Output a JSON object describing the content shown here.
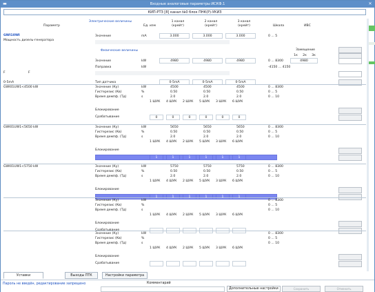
{
  "window": {
    "title": "Входные аналоговые параметры ИСКФ.1"
  },
  "subheader": "КИП-РТЗ [8] канал №0 блок ПНК(Р)-УКИЗ",
  "columns": {
    "param": "Параметр",
    "elec": "Электрические величины",
    "unit": "Ед. изм",
    "ch1": "1 канал (крейт)",
    "ch2": "2 канал (крейт)",
    "ch3": "3 канал (крейт)",
    "scale": "Шкала",
    "ivs": "ИВС"
  },
  "top": {
    "name": "GWI10WI",
    "desc": "Мощность дизель-генератора",
    "row_label": "Значение",
    "unit": "mA",
    "v1": "3.000",
    "v2": "3.000",
    "v3": "3.000",
    "scale": "0 ... 5"
  },
  "phys": {
    "header": "Физические величины",
    "zam_label": "Замещение",
    "zam_cols": [
      "1к",
      "2к",
      "3к"
    ],
    "znach": {
      "label": "Значение",
      "unit": "kW",
      "v1": "4980",
      "v2": "4980",
      "v3": "4980",
      "scale": "0 ... 8300",
      "ivs": "4980"
    },
    "popr": {
      "label": "Поправка",
      "unit": "kW",
      "scale": "-4150 ... 4150"
    },
    "f": "F",
    "f2": "F"
  },
  "tip": {
    "left": "0-5mA",
    "label": "Тип датчика",
    "v1": "0-5mA",
    "v2": "0-5mA",
    "v3": "0-5mA"
  },
  "sections": [
    {
      "name": "GWI01UW1<4500 kW",
      "rows": [
        {
          "label": "Значение (Ку)",
          "unit": "kW",
          "v": [
            "4500",
            "4500",
            "4500"
          ],
          "scale": "0 ... 8300"
        },
        {
          "label": "Гистерезис (Кв)",
          "unit": "%",
          "v": [
            "0.50",
            "0.50",
            "0.50"
          ],
          "scale": "0 ... 5"
        },
        {
          "label": "Время демпф. (Тд)",
          "unit": "s",
          "v": [
            "2.0",
            "2.0",
            "2.0"
          ],
          "scale": "0 ... 10"
        }
      ],
      "shuk": [
        "1 ШУК",
        "4 ШУК",
        "2 ШУК",
        "5 ШУК",
        "3 ШУК",
        "6 ШУК"
      ],
      "block": "Блокирование",
      "trig": "Срабатывание",
      "trigv": [
        "0",
        "0",
        "0",
        "0",
        "0",
        "0"
      ],
      "hl": false
    },
    {
      "name": "GWI01UW1<5650 kW",
      "rows": [
        {
          "label": "Значение (Ку)",
          "unit": "kW",
          "v": [
            "5650",
            "5650",
            "5650"
          ],
          "scale": "0 ... 8300"
        },
        {
          "label": "Гистерезис (Кв)",
          "unit": "%",
          "v": [
            "0.50",
            "0.50",
            "0.50"
          ],
          "scale": "0 ... 5"
        },
        {
          "label": "Время демпф. (Тд)",
          "unit": "s",
          "v": [
            "2.0",
            "2.0",
            "2.0"
          ],
          "scale": "0 ... 10"
        }
      ],
      "shuk": [
        "1 ШУК",
        "4 ШУК",
        "2 ШУК",
        "5 ШУК",
        "3 ШУК",
        "6 ШУК"
      ],
      "block": "Блокирование",
      "trig": "Срабатывание",
      "trigv": [
        "1",
        "1",
        "1",
        "1",
        "1",
        "1"
      ],
      "hl": true
    },
    {
      "name": "GWI01UW1<5750 kW",
      "rows": [
        {
          "label": "Значение (Ку)",
          "unit": "kW",
          "v": [
            "5750",
            "5750",
            "5750"
          ],
          "scale": "0 ... 8300"
        },
        {
          "label": "Гистерезис (Кв)",
          "unit": "%",
          "v": [
            "0.50",
            "0.50",
            "0.50"
          ],
          "scale": "0 ... 5"
        },
        {
          "label": "Время демпф. (Тд)",
          "unit": "s",
          "v": [
            "2.0",
            "2.0",
            "2.0"
          ],
          "scale": "0 ... 10"
        }
      ],
      "shuk": [
        "1 ШУК",
        "4 ШУК",
        "2 ШУК",
        "5 ШУК",
        "3 ШУК",
        "6 ШУК"
      ],
      "block": "Блокирование",
      "trig": "Срабатывание",
      "trigv": [
        "1",
        "1",
        "1",
        "1",
        "1",
        "1"
      ],
      "hl": true
    },
    {
      "name": "",
      "rows": [
        {
          "label": "Значение (Ку)",
          "unit": "kW",
          "v": [
            "",
            "",
            ""
          ],
          "scale": "0 ... 8300"
        },
        {
          "label": "Гистерезис (Кв)",
          "unit": "%",
          "v": [
            "",
            "",
            ""
          ],
          "scale": "0 ... 5"
        },
        {
          "label": "Время демпф. (Тд)",
          "unit": "s",
          "v": [
            "",
            "",
            ""
          ],
          "scale": "0 ... 10"
        }
      ],
      "shuk": [
        "1 ШУК",
        "4 ШУК",
        "2 ШУК",
        "5 ШУК",
        "3 ШУК",
        "6 ШУК"
      ],
      "block": "Блокирование",
      "trig": "Срабатывание",
      "trigv": [
        "",
        "",
        "",
        "",
        "",
        ""
      ],
      "hl": false
    },
    {
      "name": "",
      "rows": [
        {
          "label": "Значение (Ку)",
          "unit": "kW",
          "v": [
            "",
            "",
            ""
          ],
          "scale": "0 ... 8300"
        },
        {
          "label": "Гистерезис (Кв)",
          "unit": "%",
          "v": [
            "",
            "",
            ""
          ],
          "scale": "0 ... 5"
        },
        {
          "label": "Время демпф. (Тд)",
          "unit": "s",
          "v": [
            "",
            "",
            ""
          ],
          "scale": "0 ... 10"
        }
      ],
      "shuk": [
        "1 ШУК",
        "4 ШУК",
        "2 ШУК",
        "5 ШУК",
        "3 ШУК",
        "6 ШУК"
      ],
      "block": "Блокирование",
      "trig": "Срабатывание",
      "trigv": [
        "",
        "",
        "",
        "",
        "",
        ""
      ],
      "hl": false
    }
  ],
  "tabs": [
    "Уставки",
    "Выходы ПТК",
    "Настройки параметра"
  ],
  "status": {
    "left": "Пароль не введён, редактирование запрещено",
    "comment": "Комментарий",
    "extra": "Дополнительные настройки",
    "btn1": "Сохранить",
    "btn2": "Отменить"
  },
  "colors": {
    "titlebar": "#5d8fc9",
    "highlight": "#7a86f0",
    "side": "#64c464"
  }
}
